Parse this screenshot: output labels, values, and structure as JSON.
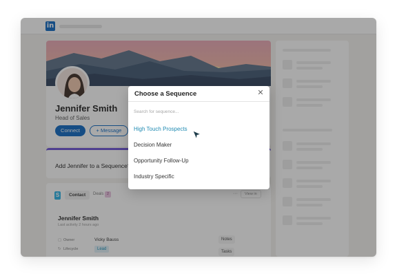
{
  "app": {
    "logo_text": "in",
    "brand_color": "#0a66c2"
  },
  "profile": {
    "name": "Jennifer Smith",
    "headline": "Head of Sales",
    "connect_label": "Connect",
    "message_label": "+ Message"
  },
  "sequence_prompt": {
    "text": "Add Jennifer to a Sequence?",
    "accent_color": "#6a4fd6"
  },
  "crm": {
    "tab_contact": "Contact",
    "tab_deals": "Deals",
    "deals_count": "2",
    "more_label": "···",
    "view_in_label": "View in",
    "contact_name": "Jennifer Smith",
    "last_activity": "Last activity 2 hours ago",
    "owner_label": "Owner",
    "owner_value": "Vicky Bauss",
    "lifecycle_label": "Lifecycle",
    "lifecycle_value": "Lead",
    "notes_label": "Notes",
    "tasks_label": "Tasks"
  },
  "modal": {
    "title": "Choose a Sequence",
    "close_icon": "close-icon",
    "search_placeholder": "Search for sequence...",
    "options": [
      {
        "label": "High Touch Prospects",
        "highlighted": true
      },
      {
        "label": "Decision Maker",
        "highlighted": false
      },
      {
        "label": "Opportunity Follow-Up",
        "highlighted": false
      },
      {
        "label": "Industry Specific",
        "highlighted": false
      }
    ],
    "highlight_color": "#1f8ab2"
  }
}
